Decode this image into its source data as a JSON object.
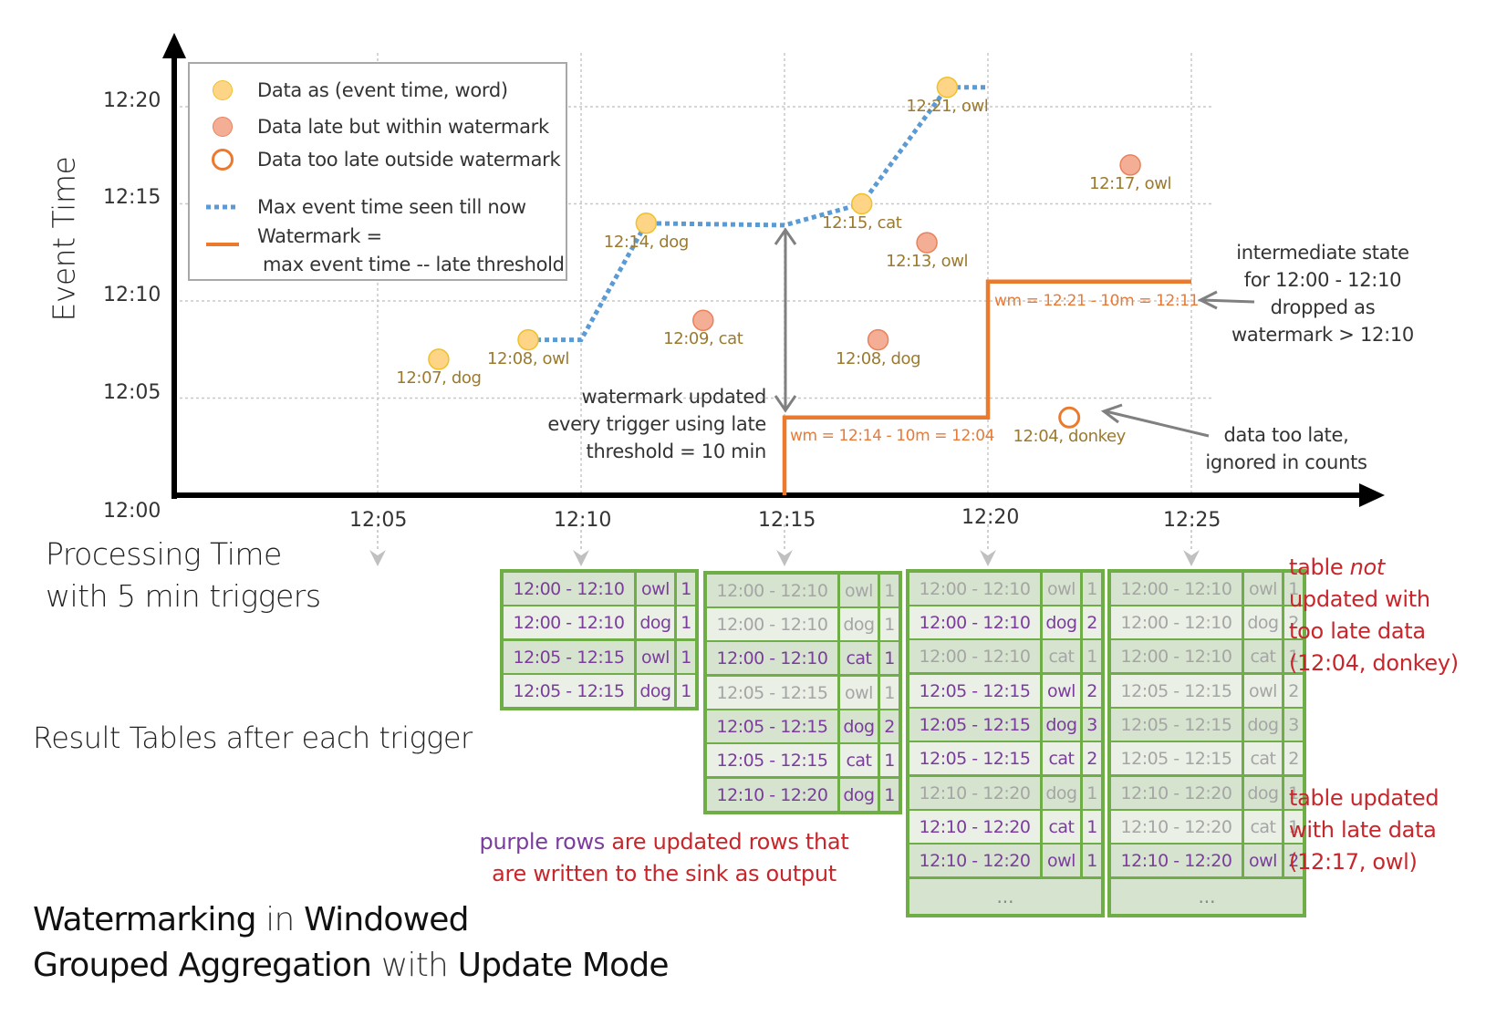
{
  "title": {
    "line1": [
      {
        "text": "Watermarking",
        "emphasis": true
      },
      {
        "text": " in ",
        "emphasis": false
      },
      {
        "text": "Windowed",
        "emphasis": true
      }
    ],
    "line2": [
      {
        "text": "Grouped Aggregation",
        "emphasis": true
      },
      {
        "text": " with ",
        "emphasis": false
      },
      {
        "text": "Update Mode",
        "emphasis": true
      }
    ]
  },
  "axes": {
    "y_label": "Event Time",
    "x_label_line1": "Processing Time",
    "x_label_line2": "with 5 min triggers",
    "y_ticks": [
      "12:00",
      "12:05",
      "12:10",
      "12:15",
      "12:20"
    ],
    "x_ticks": [
      "12:05",
      "12:10",
      "12:15",
      "12:20",
      "12:25"
    ]
  },
  "legend": {
    "on_time": "Data as (event time, word)",
    "late_within": "Data late but within watermark",
    "too_late": "Data too late outside watermark",
    "max_event": "Max event time seen till now",
    "watermark_line1": "Watermark =",
    "watermark_line2": "max event time -- late threshold"
  },
  "colors": {
    "on_time_fill": "#fed587",
    "late_fill": "#f4ae96",
    "too_late_stroke": "#ec7a2e",
    "max_event_line": "#5b9bd5",
    "watermark_line": "#ec7a2e",
    "table_border": "#6fae47",
    "updated_row_text": "#7b3c9e",
    "stale_row_text": "#a5a5a5",
    "annotation_red": "#c8262b",
    "point_label": "#9b7a2e"
  },
  "chart_data": {
    "type": "scatter",
    "title": "Watermarking in Windowed Grouped Aggregation with Update Mode",
    "xlabel": "Processing Time with 5 min triggers",
    "ylabel": "Event Time",
    "x_unit": "minutes after 12:00",
    "y_unit": "minutes after 12:00",
    "xlim": [
      0,
      28
    ],
    "ylim": [
      0,
      22
    ],
    "grid": true,
    "legend_position": "top-left",
    "points": [
      {
        "label": "12:07, dog",
        "x": 6.5,
        "y": 7,
        "kind": "on_time"
      },
      {
        "label": "12:08, owl",
        "x": 8.7,
        "y": 8,
        "kind": "on_time"
      },
      {
        "label": "12:14, dog",
        "x": 11.6,
        "y": 14,
        "kind": "on_time"
      },
      {
        "label": "12:09, cat",
        "x": 13.0,
        "y": 9,
        "kind": "late_within"
      },
      {
        "label": "12:15, cat",
        "x": 16.9,
        "y": 15,
        "kind": "on_time"
      },
      {
        "label": "12:08, dog",
        "x": 17.3,
        "y": 8,
        "kind": "late_within"
      },
      {
        "label": "12:13, owl",
        "x": 18.5,
        "y": 13,
        "kind": "late_within"
      },
      {
        "label": "12:21, owl",
        "x": 19.0,
        "y": 21,
        "kind": "on_time"
      },
      {
        "label": "12:04, donkey",
        "x": 22.0,
        "y": 4,
        "kind": "too_late"
      },
      {
        "label": "12:17, owl",
        "x": 23.5,
        "y": 17,
        "kind": "late_within"
      }
    ],
    "series": [
      {
        "name": "Max event time seen till now",
        "style": "dotted",
        "x": [
          8.7,
          10.0,
          11.6,
          15.0,
          16.9,
          19.0,
          20.0
        ],
        "y": [
          8,
          8,
          14,
          13.9,
          15,
          21,
          21
        ]
      },
      {
        "name": "Watermark",
        "style": "step",
        "x": [
          15,
          15,
          20,
          20,
          25
        ],
        "y": [
          0,
          4,
          4,
          11,
          11
        ]
      }
    ],
    "annotations": [
      {
        "text": "wm = 12:14 - 10m = 12:04",
        "x": 15.1,
        "y": 3.0
      },
      {
        "text": "wm = 12:21 - 10m = 12:11",
        "x": 20.1,
        "y": 10.0
      }
    ]
  },
  "annotations": {
    "watermark_updated": [
      "watermark updated",
      "every trigger using late",
      "threshold = 10 min"
    ],
    "intermediate_state": [
      "intermediate state",
      "for 12:00 - 12:10",
      "dropped as",
      "watermark > 12:10"
    ],
    "data_too_late": [
      "data too late,",
      "ignored in counts"
    ],
    "result_tables_label": "Result Tables after each trigger",
    "purple_caption_purple": "purple rows",
    "purple_caption_rest": " are updated rows that",
    "purple_caption_line2": "are written to the sink as output",
    "not_updated": {
      "pre": "table ",
      "em": "not",
      "line2": "updated with",
      "line3": "too late data",
      "line4": "(12:04, donkey)"
    },
    "updated_late": [
      "table updated",
      "with late data",
      "(12:17, owl)"
    ]
  },
  "tables": [
    {
      "trigger": "12:10",
      "rows": [
        {
          "window": "12:00 - 12:10",
          "word": "owl",
          "count": "1",
          "updated": true
        },
        {
          "window": "12:00 - 12:10",
          "word": "dog",
          "count": "1",
          "updated": true
        },
        {
          "window": "12:05 - 12:15",
          "word": "owl",
          "count": "1",
          "updated": true
        },
        {
          "window": "12:05 - 12:15",
          "word": "dog",
          "count": "1",
          "updated": true
        }
      ],
      "ellipsis": false
    },
    {
      "trigger": "12:15",
      "rows": [
        {
          "window": "12:00 - 12:10",
          "word": "owl",
          "count": "1",
          "updated": false
        },
        {
          "window": "12:00 - 12:10",
          "word": "dog",
          "count": "1",
          "updated": false
        },
        {
          "window": "12:00 - 12:10",
          "word": "cat",
          "count": "1",
          "updated": true
        },
        {
          "window": "12:05 - 12:15",
          "word": "owl",
          "count": "1",
          "updated": false
        },
        {
          "window": "12:05 - 12:15",
          "word": "dog",
          "count": "2",
          "updated": true
        },
        {
          "window": "12:05 - 12:15",
          "word": "cat",
          "count": "1",
          "updated": true
        },
        {
          "window": "12:10 - 12:20",
          "word": "dog",
          "count": "1",
          "updated": true
        }
      ],
      "ellipsis": false
    },
    {
      "trigger": "12:20",
      "rows": [
        {
          "window": "12:00 - 12:10",
          "word": "owl",
          "count": "1",
          "updated": false
        },
        {
          "window": "12:00 - 12:10",
          "word": "dog",
          "count": "2",
          "updated": true
        },
        {
          "window": "12:00 - 12:10",
          "word": "cat",
          "count": "1",
          "updated": false
        },
        {
          "window": "12:05 - 12:15",
          "word": "owl",
          "count": "2",
          "updated": true
        },
        {
          "window": "12:05 - 12:15",
          "word": "dog",
          "count": "3",
          "updated": true
        },
        {
          "window": "12:05 - 12:15",
          "word": "cat",
          "count": "2",
          "updated": true
        },
        {
          "window": "12:10 - 12:20",
          "word": "dog",
          "count": "1",
          "updated": false
        },
        {
          "window": "12:10 - 12:20",
          "word": "cat",
          "count": "1",
          "updated": true
        },
        {
          "window": "12:10 - 12:20",
          "word": "owl",
          "count": "1",
          "updated": true
        }
      ],
      "ellipsis": true
    },
    {
      "trigger": "12:25",
      "rows": [
        {
          "window": "12:00 - 12:10",
          "word": "owl",
          "count": "1",
          "updated": false
        },
        {
          "window": "12:00 - 12:10",
          "word": "dog",
          "count": "2",
          "updated": false
        },
        {
          "window": "12:00 - 12:10",
          "word": "cat",
          "count": "1",
          "updated": false
        },
        {
          "window": "12:05 - 12:15",
          "word": "owl",
          "count": "2",
          "updated": false
        },
        {
          "window": "12:05 - 12:15",
          "word": "dog",
          "count": "3",
          "updated": false
        },
        {
          "window": "12:05 - 12:15",
          "word": "cat",
          "count": "2",
          "updated": false
        },
        {
          "window": "12:10 - 12:20",
          "word": "dog",
          "count": "1",
          "updated": false
        },
        {
          "window": "12:10 - 12:20",
          "word": "cat",
          "count": "1",
          "updated": false
        },
        {
          "window": "12:10 - 12:20",
          "word": "owl",
          "count": "2",
          "updated": true
        }
      ],
      "ellipsis": true
    }
  ],
  "ellipsis_text": "..."
}
